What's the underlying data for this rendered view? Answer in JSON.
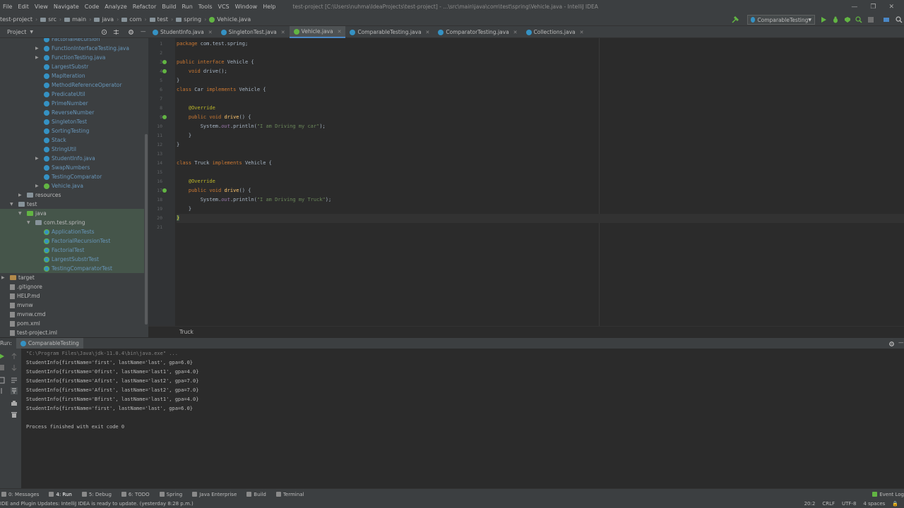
{
  "menu": {
    "items": [
      "File",
      "Edit",
      "View",
      "Navigate",
      "Code",
      "Analyze",
      "Refactor",
      "Build",
      "Run",
      "Tools",
      "VCS",
      "Window",
      "Help"
    ],
    "window_title": "test-project [C:\\Users\\nuhma\\IdeaProjects\\test-project] - ...\\src\\main\\java\\com\\test\\spring\\Vehicle.java - IntelliJ IDEA"
  },
  "nav": {
    "crumbs": [
      "test-project",
      "src",
      "main",
      "java",
      "com",
      "test",
      "spring",
      "Vehicle.java"
    ],
    "run_config": "ComparableTesting"
  },
  "project": {
    "title": "Project",
    "tree": [
      {
        "label": "FactorialRecursion",
        "indent": 62,
        "icon": "class",
        "arrow": false
      },
      {
        "label": "FunctionInterfaceTesting.java",
        "indent": 62,
        "icon": "class",
        "arrow": true
      },
      {
        "label": "FunctionTesting.java",
        "indent": 62,
        "icon": "class",
        "arrow": true
      },
      {
        "label": "LargestSubstr",
        "indent": 62,
        "icon": "class",
        "arrow": false
      },
      {
        "label": "MapIteration",
        "indent": 62,
        "icon": "class",
        "arrow": false
      },
      {
        "label": "MethodReferenceOperator",
        "indent": 62,
        "icon": "class",
        "arrow": false
      },
      {
        "label": "PredicateUtil",
        "indent": 62,
        "icon": "class",
        "arrow": false
      },
      {
        "label": "PrimeNumber",
        "indent": 62,
        "icon": "class",
        "arrow": false
      },
      {
        "label": "ReverseNumber",
        "indent": 62,
        "icon": "class",
        "arrow": false
      },
      {
        "label": "SingletonTest",
        "indent": 62,
        "icon": "class",
        "arrow": false
      },
      {
        "label": "SortingTesting",
        "indent": 62,
        "icon": "class",
        "arrow": false
      },
      {
        "label": "Stack",
        "indent": 62,
        "icon": "class",
        "arrow": false
      },
      {
        "label": "StringUtil",
        "indent": 62,
        "icon": "class",
        "arrow": false
      },
      {
        "label": "StudentInfo.java",
        "indent": 62,
        "icon": "class",
        "arrow": true
      },
      {
        "label": "SwapNumbers",
        "indent": 62,
        "icon": "class",
        "arrow": false
      },
      {
        "label": "TestingComparator",
        "indent": 62,
        "icon": "class",
        "arrow": false
      },
      {
        "label": "Vehicle.java",
        "indent": 62,
        "icon": "iface",
        "arrow": true
      },
      {
        "label": "resources",
        "indent": 38,
        "icon": "folder",
        "arrow": true
      },
      {
        "label": "test",
        "indent": 26,
        "icon": "folder",
        "arrow": true,
        "open": true
      },
      {
        "label": "java",
        "indent": 38,
        "icon": "greenfolder",
        "arrow": true,
        "open": true,
        "hl": true
      },
      {
        "label": "com.test.spring",
        "indent": 50,
        "icon": "folder",
        "arrow": true,
        "open": true,
        "hl": true
      },
      {
        "label": "ApplicationTests",
        "indent": 62,
        "icon": "test",
        "arrow": false,
        "hl": true
      },
      {
        "label": "FactorialRecursionTest",
        "indent": 62,
        "icon": "test",
        "arrow": false,
        "hl": true
      },
      {
        "label": "FactorialTest",
        "indent": 62,
        "icon": "test",
        "arrow": false,
        "hl": true
      },
      {
        "label": "LargestSubstrTest",
        "indent": 62,
        "icon": "test",
        "arrow": false,
        "hl": true
      },
      {
        "label": "TestingComparatorTest",
        "indent": 62,
        "icon": "test",
        "arrow": false,
        "hl": true
      },
      {
        "label": "target",
        "indent": 14,
        "icon": "orangefolder",
        "arrow": true
      },
      {
        "label": ".gitignore",
        "indent": 14,
        "icon": "file",
        "arrow": false
      },
      {
        "label": "HELP.md",
        "indent": 14,
        "icon": "file",
        "arrow": false
      },
      {
        "label": "mvnw",
        "indent": 14,
        "icon": "file",
        "arrow": false
      },
      {
        "label": "mvnw.cmd",
        "indent": 14,
        "icon": "file",
        "arrow": false
      },
      {
        "label": "pom.xml",
        "indent": 14,
        "icon": "file",
        "arrow": false
      },
      {
        "label": "test-project.iml",
        "indent": 14,
        "icon": "file",
        "arrow": false
      }
    ]
  },
  "tabs": [
    {
      "label": "StudentInfo.java",
      "icon": "class"
    },
    {
      "label": "SingletonTest.java",
      "icon": "class"
    },
    {
      "label": "Vehicle.java",
      "icon": "iface",
      "active": true
    },
    {
      "label": "ComparableTesting.java",
      "icon": "class"
    },
    {
      "label": "ComparatorTesting.java",
      "icon": "class"
    },
    {
      "label": "Collections.java",
      "icon": "class"
    }
  ],
  "code": [
    {
      "n": "1",
      "html": "<span class=\"kw\">package</span> com.test.spring;"
    },
    {
      "n": "2",
      "html": ""
    },
    {
      "n": "3",
      "html": "<span class=\"kw\">public interface</span> Vehicle {"
    },
    {
      "n": "4",
      "html": "    <span class=\"kw\">void</span> drive();"
    },
    {
      "n": "5",
      "html": "}"
    },
    {
      "n": "6",
      "html": "<span class=\"kw\">class</span> Car <span class=\"kw\">implements</span> Vehicle {"
    },
    {
      "n": "7",
      "html": ""
    },
    {
      "n": "8",
      "html": "    <span class=\"ann\">@Override</span>"
    },
    {
      "n": "9",
      "html": "    <span class=\"kw\">public void</span> <span class=\"mth\">drive</span>() {"
    },
    {
      "n": "10",
      "html": "        System.<span class=\"fld\">out</span>.println(<span class=\"str\">\"I am Driving my car\"</span>);"
    },
    {
      "n": "11",
      "html": "    }"
    },
    {
      "n": "12",
      "html": "}"
    },
    {
      "n": "13",
      "html": ""
    },
    {
      "n": "14",
      "html": "<span class=\"kw\">class</span> Truck <span class=\"kw\">implements</span> Vehicle {"
    },
    {
      "n": "15",
      "html": ""
    },
    {
      "n": "16",
      "html": "    <span class=\"ann\">@Override</span>"
    },
    {
      "n": "17",
      "html": "    <span class=\"kw\">public void</span> <span class=\"mth\">drive</span>() {"
    },
    {
      "n": "18",
      "html": "        System.<span class=\"fld\">out</span>.println(<span class=\"str\">\"I am Driving my Truck\"</span>);"
    },
    {
      "n": "19",
      "html": "    }"
    },
    {
      "n": "20",
      "html": "<span class=\"brace-hl\">}</span>",
      "current": true
    },
    {
      "n": "21",
      "html": ""
    }
  ],
  "editor_breadcrumb": "Truck",
  "run": {
    "label": "Run:",
    "tab": "ComparableTesting",
    "output": [
      {
        "text": "\"C:\\Program Files\\Java\\jdk-11.0.4\\bin\\java.exe\" ...",
        "cmd": true
      },
      {
        "text": "StudentInfo{firstName='first', lastName='last', gpa=6.0}"
      },
      {
        "text": "StudentInfo{firstName='0first', lastName='last1', gpa=4.0}"
      },
      {
        "text": "StudentInfo{firstName='Afirst', lastName='last2', gpa=7.0}"
      },
      {
        "text": "StudentInfo{firstName='Afirst', lastName='last2', gpa=7.0}"
      },
      {
        "text": "StudentInfo{firstName='Bfirst', lastName='last1', gpa=4.0}"
      },
      {
        "text": "StudentInfo{firstName='first', lastName='last', gpa=6.0}"
      },
      {
        "text": ""
      },
      {
        "text": "Process finished with exit code 0"
      }
    ]
  },
  "bottom_tools": [
    {
      "label": "0: Messages"
    },
    {
      "label": "4: Run",
      "active": true
    },
    {
      "label": "5: Debug"
    },
    {
      "label": "6: TODO"
    },
    {
      "label": "Spring"
    },
    {
      "label": "Java Enterprise"
    },
    {
      "label": "Build"
    },
    {
      "label": "Terminal"
    }
  ],
  "event_log": "Event Log",
  "status": {
    "message": "IDE and Plugin Updates: IntelliJ IDEA is ready to update. (yesterday 8:28 p.m.)",
    "position": "20:2",
    "line_sep": "CRLF",
    "encoding": "UTF-8",
    "indent": "4 spaces"
  },
  "colors": {
    "accent": "#4a88c7",
    "bg": "#2b2b2b",
    "panel": "#3c3f41"
  }
}
